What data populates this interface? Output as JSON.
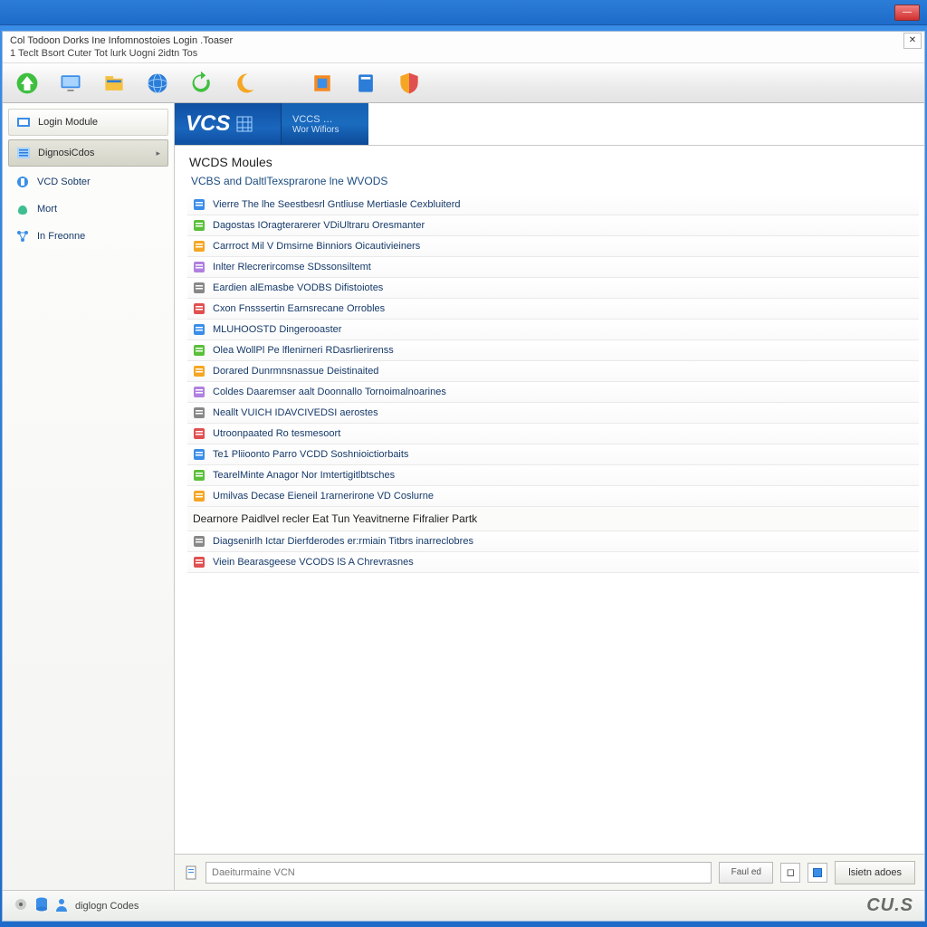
{
  "window": {
    "title": "Col Todoon Dorks Ine Infomnostoies Login .Toaser",
    "menu": "1 Teclt Bsort Cuter Tot lurk Uogni 2idtn Tos"
  },
  "toolbar_icons": [
    "home",
    "monitor",
    "folder",
    "globe",
    "refresh",
    "moon",
    "chip",
    "book",
    "shield"
  ],
  "sidebar": {
    "login_btn": "Login Module",
    "diag_btn": "DignosiCdos",
    "items": [
      {
        "icon": "device",
        "label": "VCD Sobter"
      },
      {
        "icon": "hand",
        "label": "Mort"
      },
      {
        "icon": "net",
        "label": "In Freonne"
      }
    ]
  },
  "tabs": {
    "main": "VCS",
    "sub_top": "VCCS  …",
    "sub_bottom": "Wor Wifiors"
  },
  "doc": {
    "header": "WCDS Moules",
    "sub": "VCBS and DaltlTexsprarone lne WVODS"
  },
  "items": [
    {
      "t": "item",
      "label": "Vierre The lhe Seestbesrl Gntliuse Mertiasle Cexbluiterd"
    },
    {
      "t": "item",
      "label": "Dagostas IOragterarerer VDiUltraru Oresmanter"
    },
    {
      "t": "item",
      "label": "Carrroct Mil V Dmsirne Binniors Oicautivieiners"
    },
    {
      "t": "item",
      "label": "Inlter Rlecrerircomse SDssonsiltemt"
    },
    {
      "t": "item",
      "label": "Eardien alEmasbe VODBS Difistoiotes"
    },
    {
      "t": "item",
      "label": "Cxon Fnsssertin Earnsrecane Orrobles"
    },
    {
      "t": "item",
      "label": "MLUHOOSTD Dingerooaster"
    },
    {
      "t": "item",
      "label": "Olea WollPl Pe lflenirneri RDasrlierirenss"
    },
    {
      "t": "item",
      "label": "Dorared Dunrmnsnassue Deistinaited"
    },
    {
      "t": "item",
      "label": "Coldes Daaremser aalt Doonnallo Tornoimalnoarines"
    },
    {
      "t": "item",
      "label": "Neallt VUICH IDAVCIVEDSI aerostes"
    },
    {
      "t": "item",
      "label": "Utroonpaated Ro tesmesoort"
    },
    {
      "t": "item",
      "label": "Te1 Pliioonto Parro VCDD Soshnioictiorbaits"
    },
    {
      "t": "item",
      "label": "TearelMinte Anagor Nor Imtertigitlbtsches"
    },
    {
      "t": "item",
      "label": "Umilvas Decase Eieneil 1rarnerirone VD Coslurne"
    },
    {
      "t": "group",
      "label": "Dearnore Paidlvel recler Eat Tun Yeavitnerne Fifralier Partk"
    },
    {
      "t": "item",
      "label": "Diagsenirlh Ictar Dierfderodes er:rmiain Titbrs inarreclobres"
    },
    {
      "t": "item",
      "label": "Viein Bearasgeese VCODS lS A Chrevrasnes"
    }
  ],
  "bottom": {
    "placeholder": "Daeiturmaine VCN",
    "badge": "Faul ed",
    "action": "lsietn adoes"
  },
  "footer": {
    "status": "diglogn Codes",
    "brand": "CU.S"
  }
}
